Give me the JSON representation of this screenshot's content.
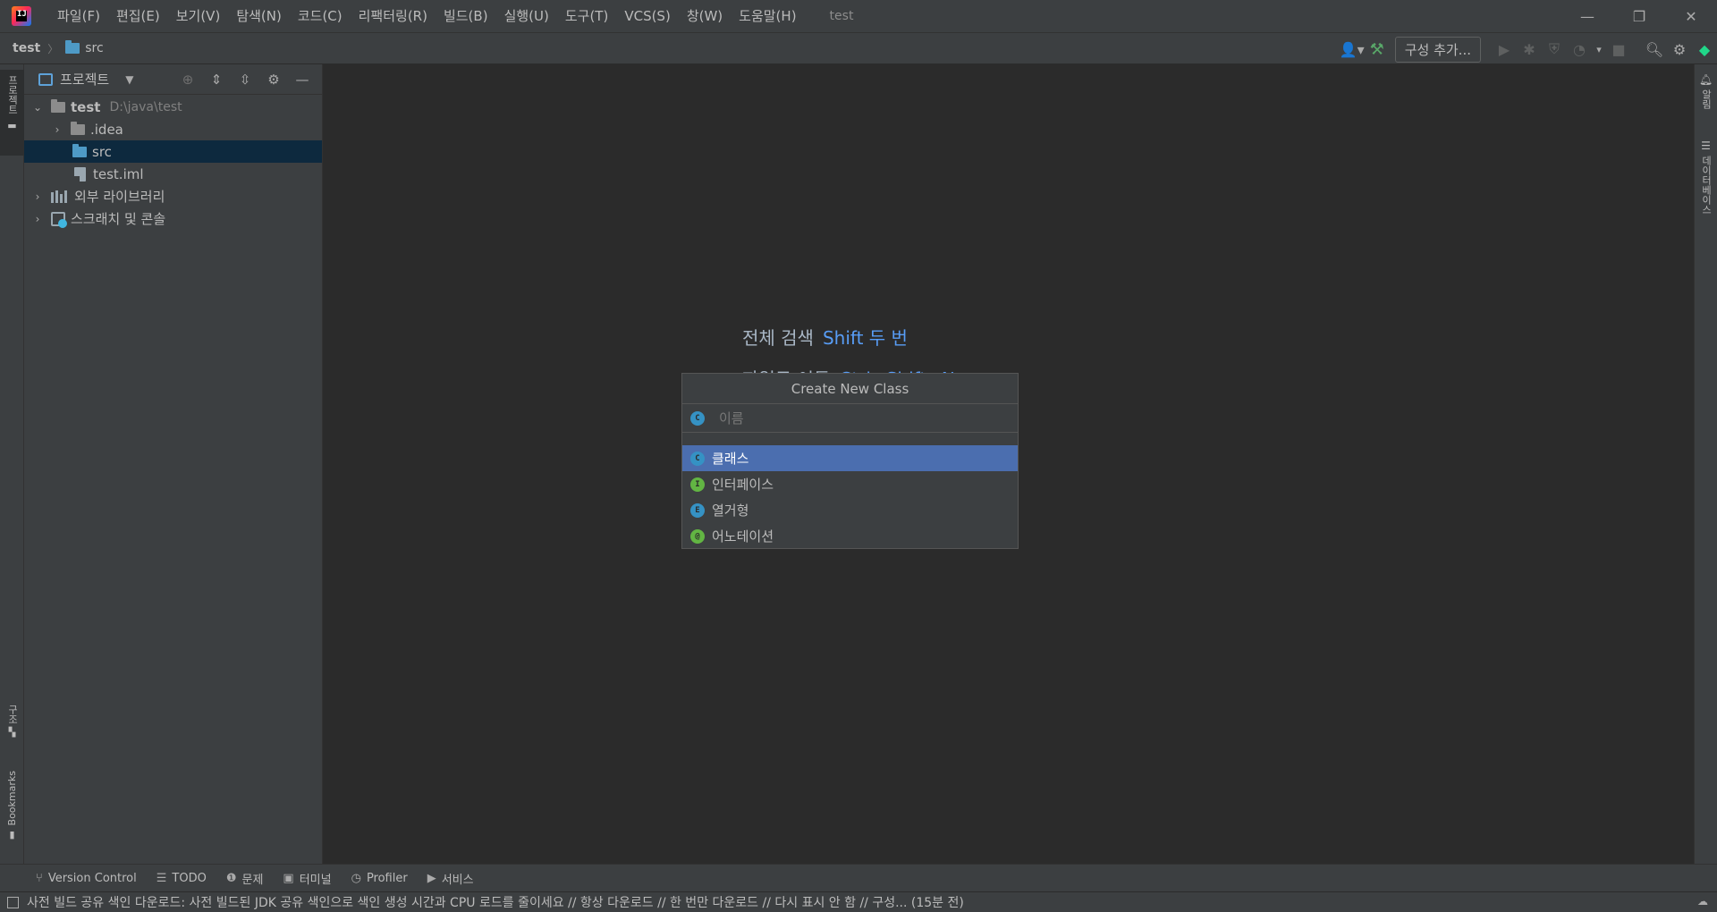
{
  "titlebar": {
    "logo_text": "IJ",
    "menu": [
      "파일(F)",
      "편집(E)",
      "보기(V)",
      "탐색(N)",
      "코드(C)",
      "리팩터링(R)",
      "빌드(B)",
      "실행(U)",
      "도구(T)",
      "VCS(S)",
      "창(W)",
      "도움말(H)"
    ],
    "window_title": "test"
  },
  "navbar": {
    "crumb_root": "test",
    "crumb_child": "src",
    "add_config_label": "구성 추가..."
  },
  "left_strip": {
    "project_tab": "프로젝트",
    "structure_tab": "구조",
    "bookmarks_tab": "Bookmarks"
  },
  "project_panel": {
    "title": "프로젝트",
    "tree": [
      {
        "label": "test",
        "hint": "D:\\java\\test"
      },
      {
        "label": ".idea"
      },
      {
        "label": "src"
      },
      {
        "label": "test.iml"
      },
      {
        "label": "외부 라이브러리"
      },
      {
        "label": "스크래치 및 콘솔"
      }
    ]
  },
  "right_strip": {
    "notifications_tab": "알림",
    "database_tab": "데이터베이스"
  },
  "editor": {
    "hint_search_label": "전체 검색",
    "hint_search_key": "Shift 두 번",
    "hint_goto_label": "파일로 이동",
    "hint_goto_key": "Ctrl+Shift+N"
  },
  "popup": {
    "title": "Create New Class",
    "input_placeholder": "이름",
    "input_value": "",
    "items": [
      {
        "label": "클래스",
        "icon": "C",
        "color": "#3592c4"
      },
      {
        "label": "인터페이스",
        "icon": "I",
        "color": "#62b543"
      },
      {
        "label": "열거형",
        "icon": "E",
        "color": "#3592c4"
      },
      {
        "label": "어노테이션",
        "icon": "@",
        "color": "#62b543"
      }
    ]
  },
  "bottom_tools": [
    "Version Control",
    "TODO",
    "문제",
    "터미널",
    "Profiler",
    "서비스"
  ],
  "statusbar": {
    "message": "사전 빌드 공유 색인 다운로드: 사전 빌드된 JDK 공유 색인으로 색인 생성 시간과 CPU 로드를 줄이세요 // 항상 다운로드 // 한 번만 다운로드 // 다시 표시 안 함 // 구성... (15분 전)"
  }
}
